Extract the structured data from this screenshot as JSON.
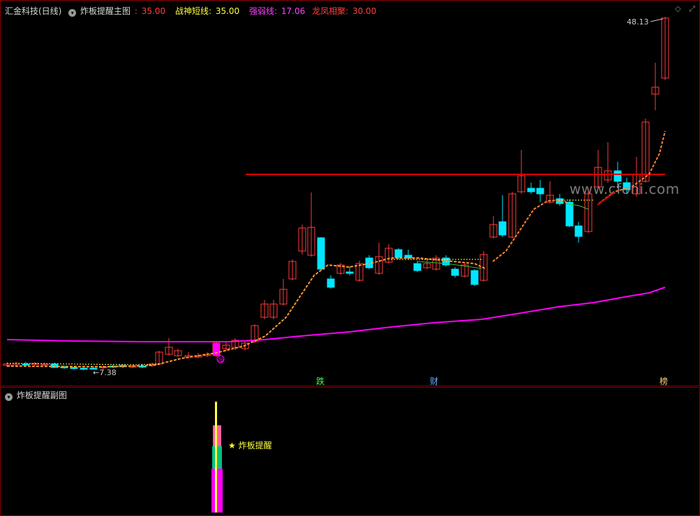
{
  "main_panel": {
    "stock_name": "汇金科技(日线)",
    "indicator_name": "炸板提醒主图",
    "params": [
      {
        "sep": ":",
        "value": "35.00",
        "color": "#ff4040",
        "label": ""
      },
      {
        "label": "战神短线:",
        "value": "35.00",
        "color": "#ffff40"
      },
      {
        "label": "强弱线:",
        "value": "17.06",
        "color": "#ff40ff"
      },
      {
        "label": "龙凤相聚:",
        "value": "30.00",
        "color": "#ff4040"
      }
    ],
    "high_marker": "48.13",
    "low_marker": "7.38",
    "event_labels": [
      {
        "text": "跌",
        "color": "#40ff40"
      },
      {
        "text": "财",
        "color": "#6aa9ff"
      },
      {
        "text": "榜",
        "color": "#ffd070"
      }
    ],
    "circle_marker": "@",
    "watermark": "www.cfoni.com",
    "top_icons": [
      "diamond-icon",
      "resize-icon"
    ]
  },
  "sub_panel": {
    "indicator_name": "炸板提醒副图",
    "alert_label": "炸板提醒",
    "alert_star": "★"
  },
  "colors": {
    "up": "#ff3c3c",
    "down": "#00e5ff",
    "magenta": "#ff00ff",
    "line_red": "#e00000",
    "ma_yellow": "#ffff40",
    "ma_green": "#30c030",
    "dashed_orange": "#ff8030"
  }
}
